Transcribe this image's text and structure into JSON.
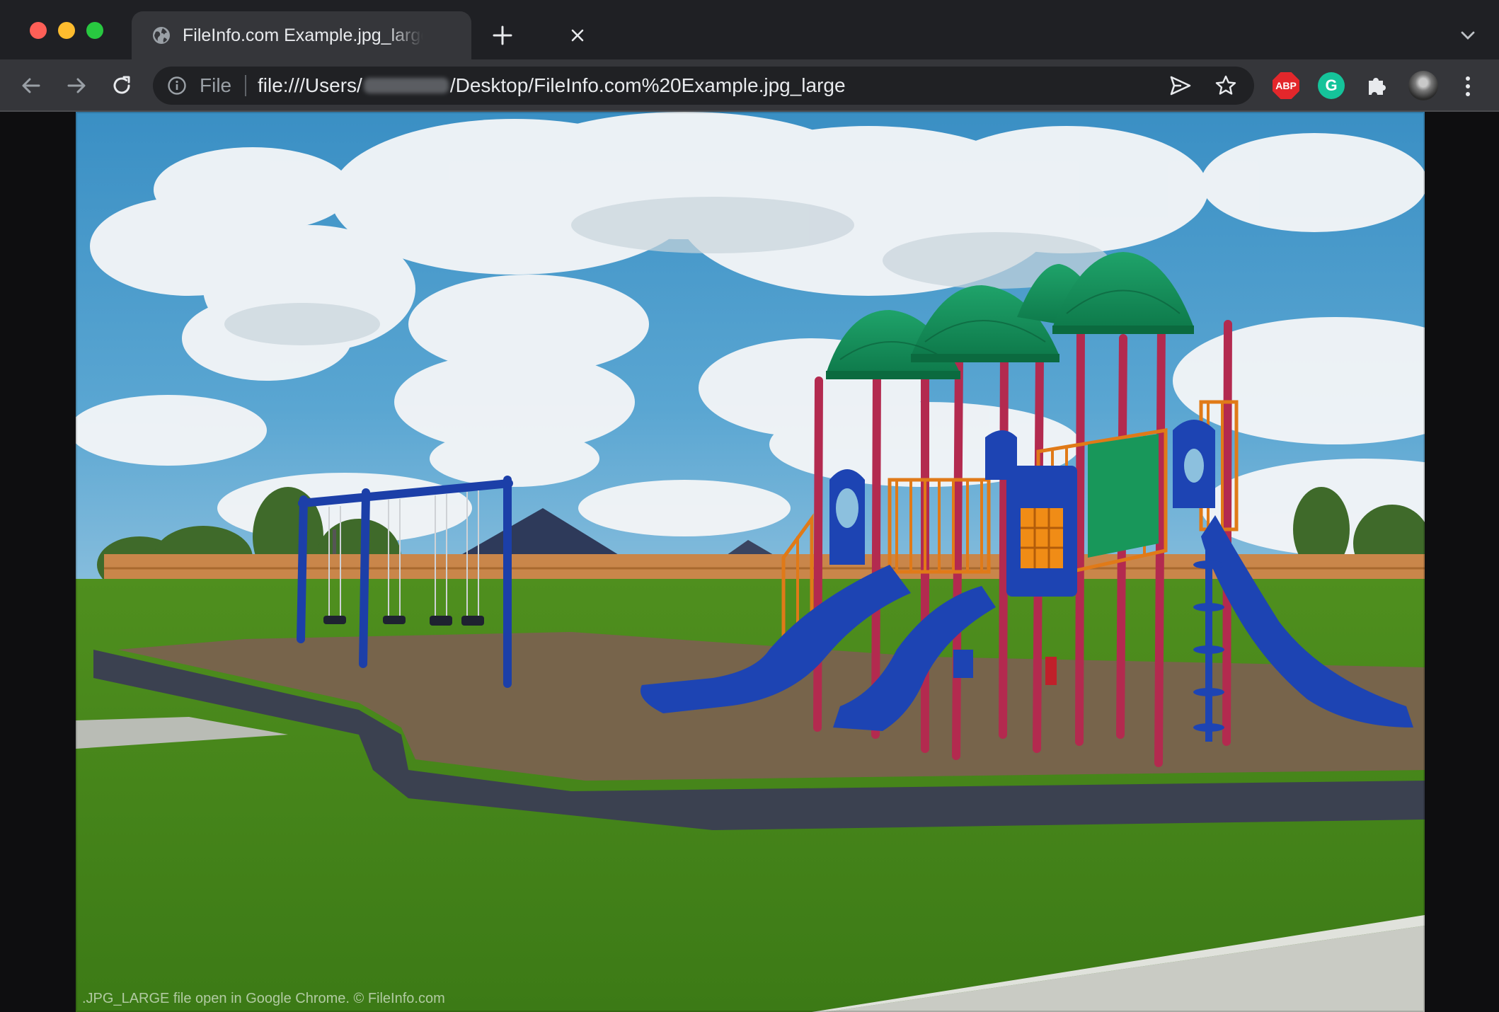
{
  "window": {
    "tab": {
      "title": "FileInfo.com Example.jpg_large",
      "favicon": "globe-icon",
      "close_icon": "close-icon"
    },
    "new_tab_icon": "plus-icon",
    "tab_search_icon": "chevron-down-icon"
  },
  "toolbar": {
    "back_icon": "arrow-left-icon",
    "forward_icon": "arrow-right-icon",
    "reload_icon": "reload-icon",
    "omnibox": {
      "security_icon": "info-icon",
      "chip_label": "File",
      "url_prefix": "file:///Users/",
      "url_suffix": "/Desktop/FileInfo.com%20Example.jpg_large",
      "send_icon": "send-icon",
      "bookmark_icon": "star-icon"
    },
    "extensions": {
      "adblock_label": "ABP",
      "grammarly_label": "G",
      "puzzle_icon": "puzzle-icon",
      "profile_icon": "avatar"
    },
    "menu_icon": "kebab-menu-icon"
  },
  "content": {
    "image_subject": "playground photo",
    "caption": ".JPG_LARGE file open in Google Chrome. © FileInfo.com"
  },
  "colors": {
    "titlebar": "#1f2024",
    "toolbar": "#35363a",
    "omnibox": "#202124",
    "text": "#e8eaed",
    "muted": "#9aa0a6",
    "abp_red": "#e3272b",
    "grammarly_green": "#15c39a"
  }
}
